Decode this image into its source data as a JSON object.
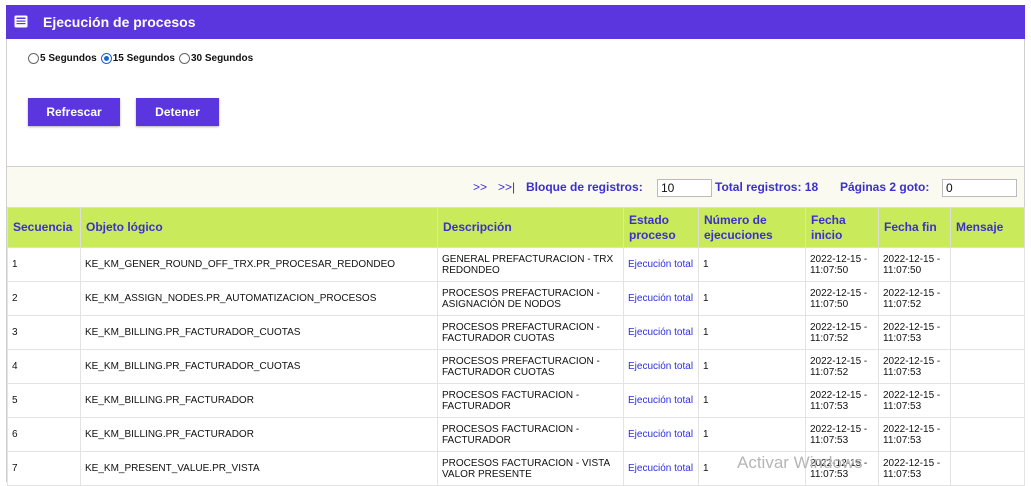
{
  "header": {
    "title": "Ejecución de procesos"
  },
  "refresh_options": [
    {
      "label": "5 Segundos",
      "checked": false
    },
    {
      "label": "15 Segundos",
      "checked": true
    },
    {
      "label": "30 Segundos",
      "checked": false
    }
  ],
  "buttons": {
    "refresh": "Refrescar",
    "stop": "Detener"
  },
  "pager": {
    "next": ">>",
    "last": ">>|",
    "block_label": "Bloque de registros:",
    "block_value": "10",
    "total_label": "Total registros: 18",
    "pages_label": "Páginas 2 goto:",
    "goto_value": "0"
  },
  "table": {
    "headers": [
      "Secuencia",
      "Objeto lógico",
      "Descripción",
      "Estado proceso",
      "Número de ejecuciones",
      "Fecha inicio",
      "Fecha fin",
      "Mensaje"
    ],
    "rows": [
      [
        "1",
        "KE_KM_GENER_ROUND_OFF_TRX.PR_PROCESAR_REDONDEO",
        "GENERAL PREFACTURACION - TRX REDONDEO",
        "Ejecución total",
        "1",
        "2022-12-15 - 11:07:50",
        "2022-12-15 - 11:07:50",
        ""
      ],
      [
        "2",
        "KE_KM_ASSIGN_NODES.PR_AUTOMATIZACION_PROCESOS",
        "PROCESOS PREFACTURACION - ASIGNACIÓN DE NODOS",
        "Ejecución total",
        "1",
        "2022-12-15 - 11:07:50",
        "2022-12-15 - 11:07:52",
        ""
      ],
      [
        "3",
        "KE_KM_BILLING.PR_FACTURADOR_CUOTAS",
        "PROCESOS PREFACTURACION - FACTURADOR CUOTAS",
        "Ejecución total",
        "1",
        "2022-12-15 - 11:07:52",
        "2022-12-15 - 11:07:53",
        ""
      ],
      [
        "4",
        "KE_KM_BILLING.PR_FACTURADOR_CUOTAS",
        "PROCESOS PREFACTURACION - FACTURADOR CUOTAS",
        "Ejecución total",
        "1",
        "2022-12-15 - 11:07:52",
        "2022-12-15 - 11:07:53",
        ""
      ],
      [
        "5",
        "KE_KM_BILLING.PR_FACTURADOR",
        "PROCESOS FACTURACION - FACTURADOR",
        "Ejecución total",
        "1",
        "2022-12-15 - 11:07:53",
        "2022-12-15 - 11:07:53",
        ""
      ],
      [
        "6",
        "KE_KM_BILLING.PR_FACTURADOR",
        "PROCESOS FACTURACION - FACTURADOR",
        "Ejecución total",
        "1",
        "2022-12-15 - 11:07:53",
        "2022-12-15 - 11:07:53",
        ""
      ],
      [
        "7",
        "KE_KM_PRESENT_VALUE.PR_VISTA",
        "PROCESOS FACTURACION - VISTA VALOR PRESENTE",
        "Ejecución total",
        "1",
        "2022-12-15 - 11:07:53",
        "2022-12-15 - 11:07:53",
        ""
      ]
    ]
  },
  "watermark": "Activar Windows"
}
